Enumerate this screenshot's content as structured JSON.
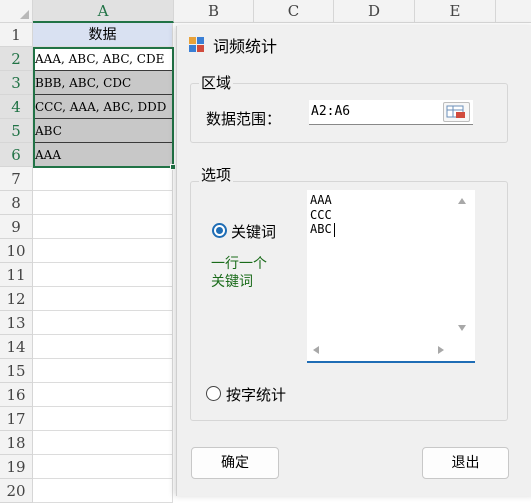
{
  "sheet": {
    "columns": [
      "A",
      "B",
      "C",
      "D",
      "E"
    ],
    "rows": [
      "1",
      "2",
      "3",
      "4",
      "5",
      "6",
      "7",
      "8",
      "9",
      "10",
      "11",
      "12",
      "13",
      "14",
      "15",
      "16",
      "17",
      "18",
      "19",
      "20"
    ],
    "cells": [
      "数据",
      "AAA, ABC, ABC, CDE",
      "BBB, ABC, CDC",
      "CCC, AAA, ABC, DDD",
      "ABC",
      "AAA"
    ]
  },
  "dialog": {
    "title": "词频统计",
    "region_label": "区域",
    "range_label": "数据范围：",
    "range_value": "A2:A6",
    "options_label": "选项",
    "radio_keyword": "关键词",
    "hint_line1": "一行一个",
    "hint_line2": "关键词",
    "keywords_text": "AAA\nCCC\nABC",
    "radio_char": "按字统计",
    "ok_label": "确定",
    "exit_label": "退出"
  },
  "colors": {
    "accent": "#217346",
    "hint_green": "#1a6b1a",
    "radio_blue": "#1f6db5"
  },
  "icons": [
    "app-icon",
    "range-select-icon",
    "scroll-up-icon",
    "scroll-down-icon",
    "scroll-left-icon",
    "scroll-right-icon"
  ]
}
